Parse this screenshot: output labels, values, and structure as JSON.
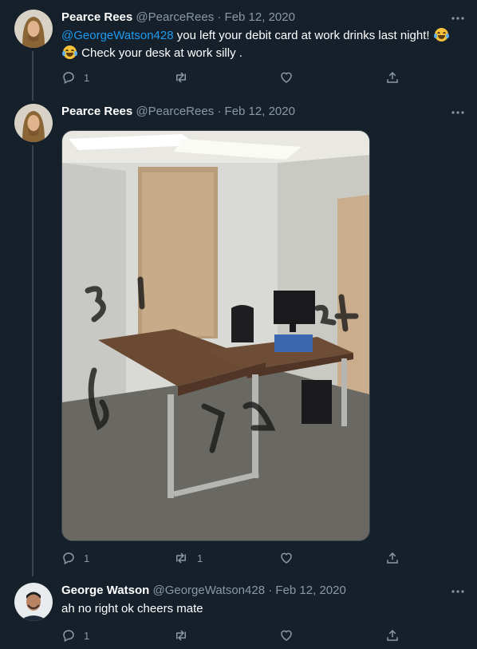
{
  "tweets": [
    {
      "author_name": "Pearce Rees",
      "handle": "@PearceRees",
      "separator": "·",
      "date": "Feb 12, 2020",
      "mention": "@GeorgeWatson428",
      "text_after_mention": " you left your debit card at work drinks last night! ",
      "text_line2": " Check  your  desk  at  work  silly .",
      "reply_count": "1",
      "retweet_count": "",
      "like_count": "",
      "avatar": "long-haired-man-avatar"
    },
    {
      "author_name": "Pearce Rees",
      "handle": "@PearceRees",
      "separator": "·",
      "date": "Feb 12, 2020",
      "image_alt": "office-photo-with-desk",
      "reply_count": "1",
      "retweet_count": "1",
      "like_count": "",
      "avatar": "long-haired-man-avatar"
    },
    {
      "author_name": "George Watson",
      "handle": "@GeorgeWatson428",
      "separator": "·",
      "date": "Feb 12, 2020",
      "text": "ah no right ok cheers mate",
      "reply_count": "1",
      "retweet_count": "",
      "like_count": "",
      "avatar": "short-haired-man-avatar"
    }
  ],
  "icons": {
    "reply": "reply-icon",
    "retweet": "retweet-icon",
    "like": "heart-icon",
    "share": "share-icon",
    "more": "more-options-icon",
    "emoji": "tears-of-joy-emoji"
  },
  "colors": {
    "background": "#15202b",
    "link": "#1d9bf0",
    "muted": "#8b98a5",
    "divider": "#38444d"
  }
}
